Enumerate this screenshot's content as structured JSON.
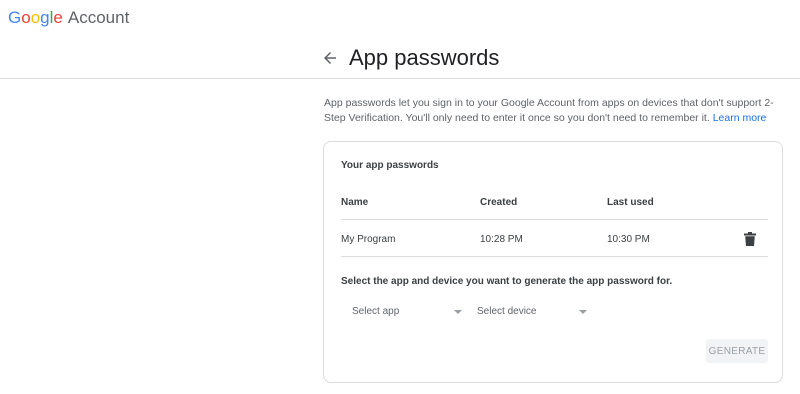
{
  "header": {
    "logo_letters": [
      {
        "ch": "G",
        "color": "#4285F4"
      },
      {
        "ch": "o",
        "color": "#EA4335"
      },
      {
        "ch": "o",
        "color": "#FBBC05"
      },
      {
        "ch": "g",
        "color": "#4285F4"
      },
      {
        "ch": "l",
        "color": "#34A853"
      },
      {
        "ch": "e",
        "color": "#EA4335"
      }
    ],
    "logo_word": "Account"
  },
  "page": {
    "title": "App passwords",
    "back_icon": "arrow-back-icon",
    "intro_text": "App passwords let you sign in to your Google Account from apps on devices that don't support 2-Step Verification. You'll only need to enter it once so you don't need to remember it.",
    "learn_more": "Learn more"
  },
  "card": {
    "title": "Your app passwords",
    "columns": {
      "name": "Name",
      "created": "Created",
      "last_used": "Last used"
    },
    "rows": [
      {
        "name": "My Program",
        "created": "10:28 PM",
        "last_used": "10:30 PM",
        "action_icon": "trash-icon"
      }
    ],
    "generate_label": "Select the app and device you want to generate the app password for.",
    "select_app": "Select app",
    "select_device": "Select device",
    "generate_button": "GENERATE"
  },
  "colors": {
    "link": "#1a73e8",
    "divider": "#dadce0",
    "text": "#202124",
    "muted": "#5f6368"
  }
}
